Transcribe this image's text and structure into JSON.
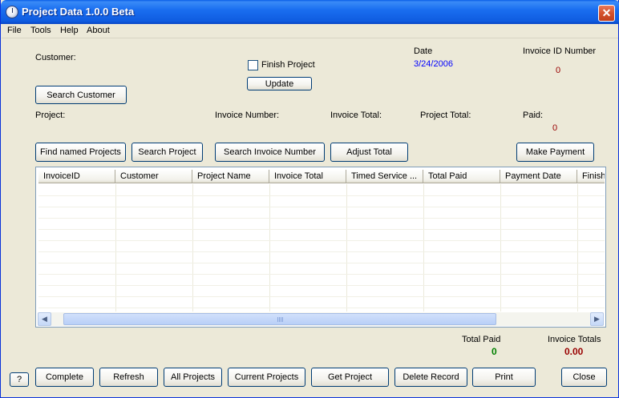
{
  "window": {
    "title": "Project Data 1.0.0 Beta",
    "close_label": "✕"
  },
  "menu": [
    "File",
    "Tools",
    "Help",
    "About"
  ],
  "form": {
    "customer_label": "Customer:",
    "finish_project_label": "Finish Project",
    "update_label": "Update",
    "date_label": "Date",
    "date_value": "3/24/2006",
    "invoice_id_label": "Invoice ID Number",
    "invoice_id_value": "0",
    "search_customer_label": "Search Customer",
    "project_label": "Project:",
    "invoice_number_label": "Invoice Number:",
    "invoice_total_label": "Invoice Total:",
    "project_total_label": "Project Total:",
    "paid_label": "Paid:",
    "paid_value": "0"
  },
  "actions": {
    "find_named_projects": "Find named Projects",
    "search_project": "Search Project",
    "search_invoice_number": "Search Invoice Number",
    "adjust_total": "Adjust Total",
    "make_payment": "Make Payment"
  },
  "table": {
    "columns": [
      "InvoiceID",
      "Customer",
      "Project Name",
      "Invoice Total",
      "Timed Service ...",
      "Total Paid",
      "Payment Date",
      "Finish"
    ],
    "rows": []
  },
  "scroll": {
    "left_arrow": "◀",
    "right_arrow": "▶"
  },
  "totals": {
    "total_paid_label": "Total Paid",
    "total_paid_value": "0",
    "invoice_totals_label": "Invoice Totals",
    "invoice_totals_value": "0.00"
  },
  "bottom": {
    "help_label": "?",
    "complete": "Complete",
    "refresh": "Refresh",
    "all_projects": "All Projects",
    "current_projects": "Current Projects",
    "get_project": "Get Project",
    "delete_record": "Delete Record",
    "print": "Print",
    "close": "Close"
  },
  "colors": {
    "titlebar": "#0a5ee8",
    "date_text": "#0000ff",
    "value_red": "#990000",
    "total_green": "#008000"
  }
}
